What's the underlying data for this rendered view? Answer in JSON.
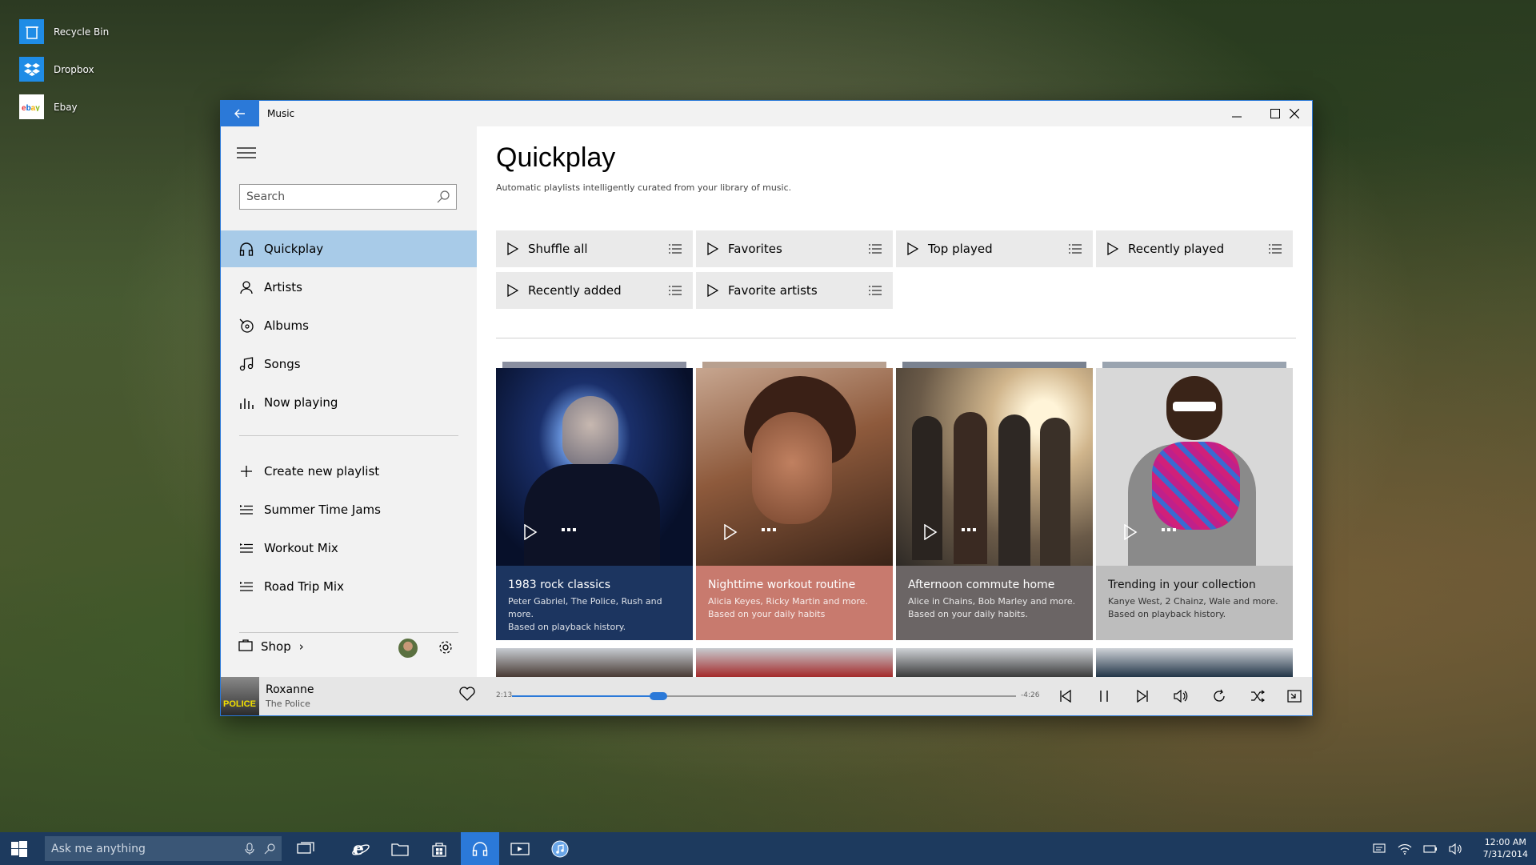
{
  "desktop": {
    "icons": [
      {
        "label": "Recycle Bin",
        "icon": "recycle-bin-icon"
      },
      {
        "label": "Dropbox",
        "icon": "dropbox-icon"
      },
      {
        "label": "Ebay",
        "icon": "ebay-icon"
      }
    ]
  },
  "window": {
    "title": "Music",
    "accent": "#2b79d8"
  },
  "nav": {
    "search_placeholder": "Search",
    "items": [
      {
        "label": "Quickplay",
        "icon": "headphones-icon",
        "active": true
      },
      {
        "label": "Artists",
        "icon": "person-icon"
      },
      {
        "label": "Albums",
        "icon": "album-icon"
      },
      {
        "label": "Songs",
        "icon": "music-note-icon"
      },
      {
        "label": "Now playing",
        "icon": "bars-icon"
      }
    ],
    "playlists": [
      {
        "label": "Create new playlist",
        "icon": "plus-icon"
      },
      {
        "label": "Summer Time Jams",
        "icon": "playlist-icon"
      },
      {
        "label": "Workout Mix",
        "icon": "playlist-icon"
      },
      {
        "label": "Road Trip Mix",
        "icon": "playlist-icon"
      }
    ],
    "shop_label": "Shop",
    "shop_chevron": "›"
  },
  "main": {
    "title": "Quickplay",
    "subtitle": "Automatic playlists intelligently curated from your library of music.",
    "quickplay_buttons": [
      {
        "label": "Shuffle all"
      },
      {
        "label": "Favorites"
      },
      {
        "label": "Top played"
      },
      {
        "label": "Recently played"
      },
      {
        "label": "Recently added"
      },
      {
        "label": "Favorite artists"
      }
    ],
    "cards": [
      {
        "title": "1983 rock classics",
        "line1": "Peter Gabriel, The Police, Rush and more.",
        "line2": "Based on playback history.",
        "color": "#1c3560"
      },
      {
        "title": "Nighttime workout routine",
        "line1": "Alicia Keyes, Ricky Martin and more.",
        "line2": "Based on your daily habits",
        "color": "#c87a6e"
      },
      {
        "title": "Afternoon commute home",
        "line1": "Alice in Chains, Bob Marley and more.",
        "line2": "Based on your daily habits.",
        "color": "#6b6565"
      },
      {
        "title": "Trending in your collection",
        "line1": "Kanye West, 2 Chainz, Wale and more.",
        "line2": "Based on playback history.",
        "color": "#bdbdbd"
      }
    ]
  },
  "now_playing": {
    "song": "Roxanne",
    "artist": "The Police",
    "elapsed": "2:13",
    "remaining": "-4:26",
    "progress": 0.29,
    "album_text": "POLICE"
  },
  "taskbar": {
    "search_placeholder": "Ask me anything",
    "time": "12:00 AM",
    "date": "7/31/2014"
  }
}
